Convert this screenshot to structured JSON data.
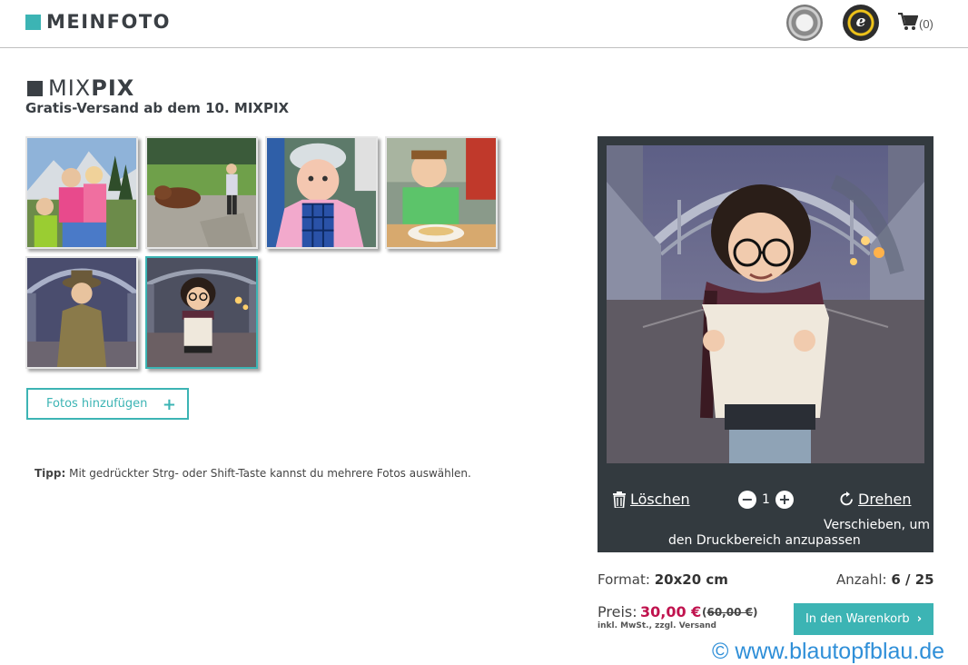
{
  "header": {
    "logo_text": "MEINFOTO",
    "cart_count": "(0)",
    "icons": [
      "seal-badge-icon",
      "trusted-shops-icon",
      "cart-icon"
    ]
  },
  "product": {
    "title_light": "MIX",
    "title_bold": "PIX",
    "subtitle": "Gratis-Versand ab dem 10. MIXPIX"
  },
  "thumbnails": [
    {
      "name": "family-mountains"
    },
    {
      "name": "child-with-cow"
    },
    {
      "name": "toddler-pink-jacket"
    },
    {
      "name": "boy-at-table"
    },
    {
      "name": "child-in-hat"
    },
    {
      "name": "child-with-glasses",
      "selected": true
    }
  ],
  "actions": {
    "add_photos_label": "Fotos hinzufügen",
    "add_photos_icon": "+"
  },
  "tip": {
    "label": "Tipp:",
    "text": " Mit gedrückter Strg- oder Shift-Taste kannst du mehrere Fotos auswählen."
  },
  "editor": {
    "delete_label": "Löschen",
    "rotate_label": "Drehen",
    "quantity": "1",
    "minus": "−",
    "plus": "+",
    "hint_line1": "Verschieben, um",
    "hint_line2": "den Druckbereich anzupassen"
  },
  "info": {
    "format_label": "Format:",
    "format_value": "20x20 cm",
    "count_label": "Anzahl:",
    "count_value": "6 / 25",
    "price_label": "Preis:",
    "price_value": "30,00 €",
    "price_old_open": "(",
    "price_old": "60,00 €",
    "price_old_close": ")",
    "vat_note": "inkl. MwSt., zzgl. Versand",
    "cart_button": "In den Warenkorb",
    "cart_button_chevron": "›"
  },
  "watermark": "© www.blautopfblau.de",
  "colors": {
    "accent": "#3cb4b4",
    "dark": "#333a3f",
    "price": "#c0134e",
    "watermark": "#2f8fd8"
  }
}
